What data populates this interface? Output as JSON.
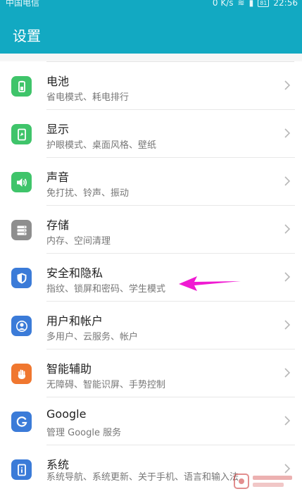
{
  "status_bar": {
    "carrier": "中国电信",
    "speed": "0 K/s",
    "battery": "81",
    "time": "22:56"
  },
  "header": {
    "title": "设置"
  },
  "items": [
    {
      "title": "电池",
      "subtitle": "省电模式、耗电排行",
      "icon": "battery-icon",
      "color": "#3fc46a"
    },
    {
      "title": "显示",
      "subtitle": "护眼模式、桌面风格、壁纸",
      "icon": "display-icon",
      "color": "#3fc46a"
    },
    {
      "title": "声音",
      "subtitle": "免打扰、铃声、振动",
      "icon": "speaker-icon",
      "color": "#3fc46a"
    },
    {
      "title": "存储",
      "subtitle": "内存、空间清理",
      "icon": "storage-icon",
      "color": "#8e8e8e"
    },
    {
      "title": "安全和隐私",
      "subtitle": "指纹、锁屏和密码、学生模式",
      "icon": "shield-icon",
      "color": "#3b7bd8"
    },
    {
      "title": "用户和帐户",
      "subtitle": "多用户、云服务、帐户",
      "icon": "user-icon",
      "color": "#3b7bd8"
    },
    {
      "title": "智能辅助",
      "subtitle": "无障碍、智能识屏、手势控制",
      "icon": "hand-icon",
      "color": "#f0772f"
    },
    {
      "title": "Google",
      "subtitle": "管理 Google 服务",
      "icon": "google-icon",
      "color": "#3b7bd8"
    },
    {
      "title": "系统",
      "subtitle": "系统导航、系统更新、关于手机、语言和输入法",
      "icon": "system-icon",
      "color": "#3b7bd8"
    }
  ],
  "colors": {
    "header_bg": "#12a9c2",
    "annotation_arrow": "#f01ad2"
  }
}
